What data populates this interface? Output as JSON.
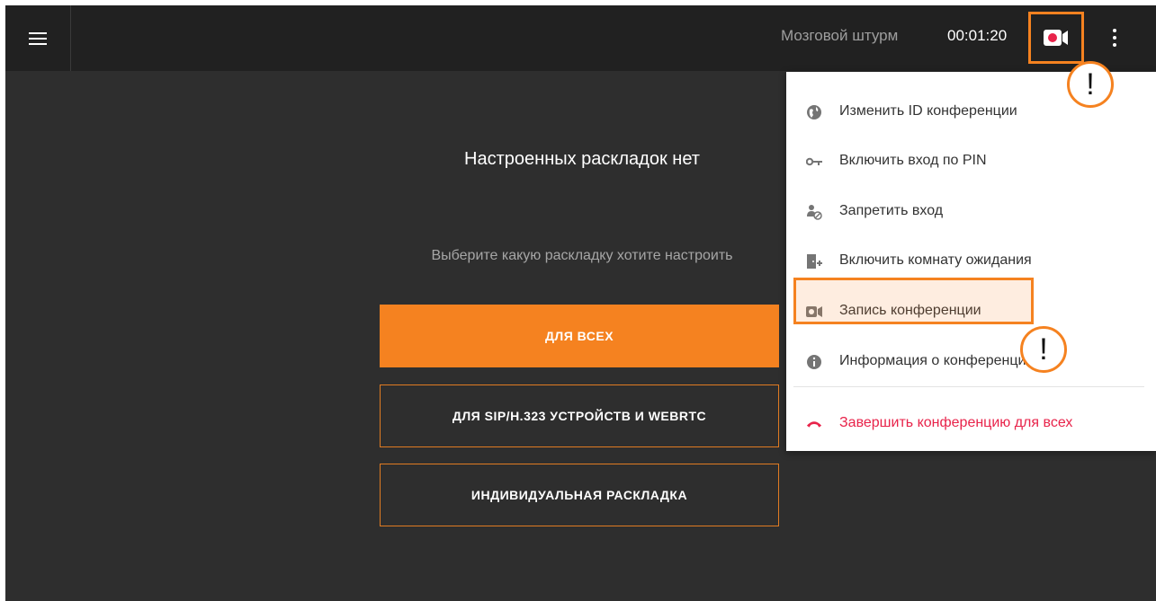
{
  "topbar": {
    "conference_name": "Мозговой штурм",
    "timer": "00:01:20"
  },
  "main": {
    "empty_title": "Настроенных раскладок нет",
    "subtitle": "Выберите какую раскладку хотите настроить",
    "buttons": {
      "for_all": "ДЛЯ ВСЕХ",
      "for_sip": "ДЛЯ SIP/H.323 УСТРОЙСТВ И WEBRTC",
      "individual": "ИНДИВИДУАЛЬНАЯ РАСКЛАДКА"
    }
  },
  "menu": {
    "items": [
      {
        "label": "Изменить ID конференции",
        "icon": "globe-icon"
      },
      {
        "label": "Включить вход по PIN",
        "icon": "key-icon"
      },
      {
        "label": "Запретить вход",
        "icon": "person-blocked-icon"
      },
      {
        "label": "Включить комнату ожидания",
        "icon": "door-add-icon"
      },
      {
        "label": "Запись конференции",
        "icon": "video-record-icon"
      },
      {
        "label": "Информация о конференции",
        "icon": "info-icon"
      }
    ],
    "end_conference": {
      "label": "Завершить конференцию для всех",
      "icon": "hang-up-icon",
      "color": "#e8234a"
    }
  },
  "annotations": {
    "badge_1": "!",
    "badge_2": "!"
  },
  "colors": {
    "accent": "#f58220",
    "record": "#e8234a"
  }
}
